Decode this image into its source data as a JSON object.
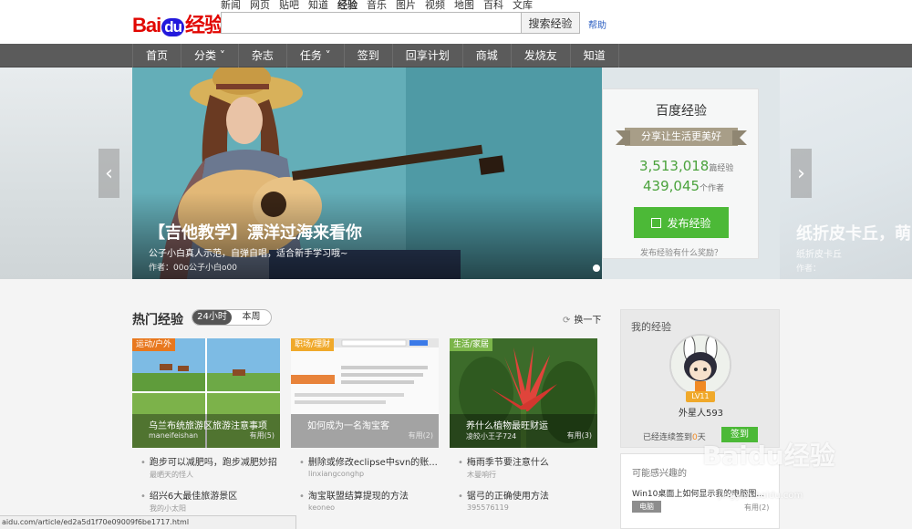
{
  "logo": {
    "bai": "Bai",
    "du": "du",
    "jy": "经验"
  },
  "topnav": [
    "新闻",
    "网页",
    "贴吧",
    "知道",
    "经验",
    "音乐",
    "图片",
    "视频",
    "地图",
    "百科",
    "文库"
  ],
  "search": {
    "placeholder": "",
    "button": "搜索经验",
    "help": "帮助"
  },
  "navbar": [
    "首页",
    "分类 ˅",
    "杂志",
    "任务 ˅",
    "签到",
    "回享计划",
    "商城",
    "发烧友",
    "知道"
  ],
  "banner": {
    "title": "【吉他教学】漂洋过海来看你",
    "subtitle": "公子小白真人示范，自弹自唱，适合新手学习哦~",
    "author": "作者：00o公子小白o00",
    "next_title": "纸折皮卡丘，萌",
    "next_subtitle": "纸折皮卡丘",
    "next_author": "作者：",
    "prev_arrow": "‹",
    "next_arrow": "›"
  },
  "stats": {
    "title": "百度经验",
    "slogan": "分享让生活更美好",
    "articles": "3,513,018",
    "articles_unit": "篇经验",
    "authors": "439,045",
    "authors_unit": "个作者",
    "publish": "发布经验",
    "reward": "发布经验有什么奖励？"
  },
  "hot": {
    "title": "热门经验",
    "tabs": [
      "24小时",
      "本周"
    ],
    "refresh": "换一下",
    "cards": [
      {
        "tag": "运动/户外",
        "tag_color": "#e8781e",
        "title": "乌兰布统旅游区旅游注意事项",
        "author": "maneifeishan",
        "use": "有用(5)"
      },
      {
        "tag": "职场/理财",
        "tag_color": "#f0a92b",
        "title": "如何成为一名淘宝客",
        "author": "",
        "use": "有用(2)"
      },
      {
        "tag": "生活/家居",
        "tag_color": "#7bb54a",
        "title": "养什么植物最旺财运",
        "author": "凌皎小王子724",
        "use": "有用(3)"
      }
    ],
    "list": [
      [
        {
          "title": "跑步可以减肥吗，跑步减肥妙招",
          "author": "最晒天的怪人"
        },
        {
          "title": "绍兴6大最佳旅游景区",
          "author": "我的小太阳"
        }
      ],
      [
        {
          "title": "删除或修改eclipse中svn的账...",
          "author": "linxiangconghp"
        },
        {
          "title": "淘宝联盟结算提现的方法",
          "author": "keoneo"
        }
      ],
      [
        {
          "title": "梅雨季节要注意什么",
          "author": "木曼响行"
        },
        {
          "title": "锯弓的正确使用方法",
          "author": "395576119"
        }
      ]
    ]
  },
  "sidebar": {
    "my_title": "我的经验",
    "level": "LV11",
    "username": "外星人593",
    "sign_text_pre": "已经连续",
    "sign_text_mid": "签到",
    "sign_days": "0",
    "sign_text_post": "天",
    "sign_button": "签到",
    "interest_title": "可能感兴趣的",
    "interest_item": "Win10桌面上如何显示我的电脑图...",
    "interest_tag": "电脑",
    "interest_use": "有用(2)"
  },
  "watermark": {
    "logo": "Baidu经验",
    "url": "jingyan.baidu.com"
  },
  "status_url": "aidu.com/article/ed2a5d1f70e09009f6be1717.html"
}
